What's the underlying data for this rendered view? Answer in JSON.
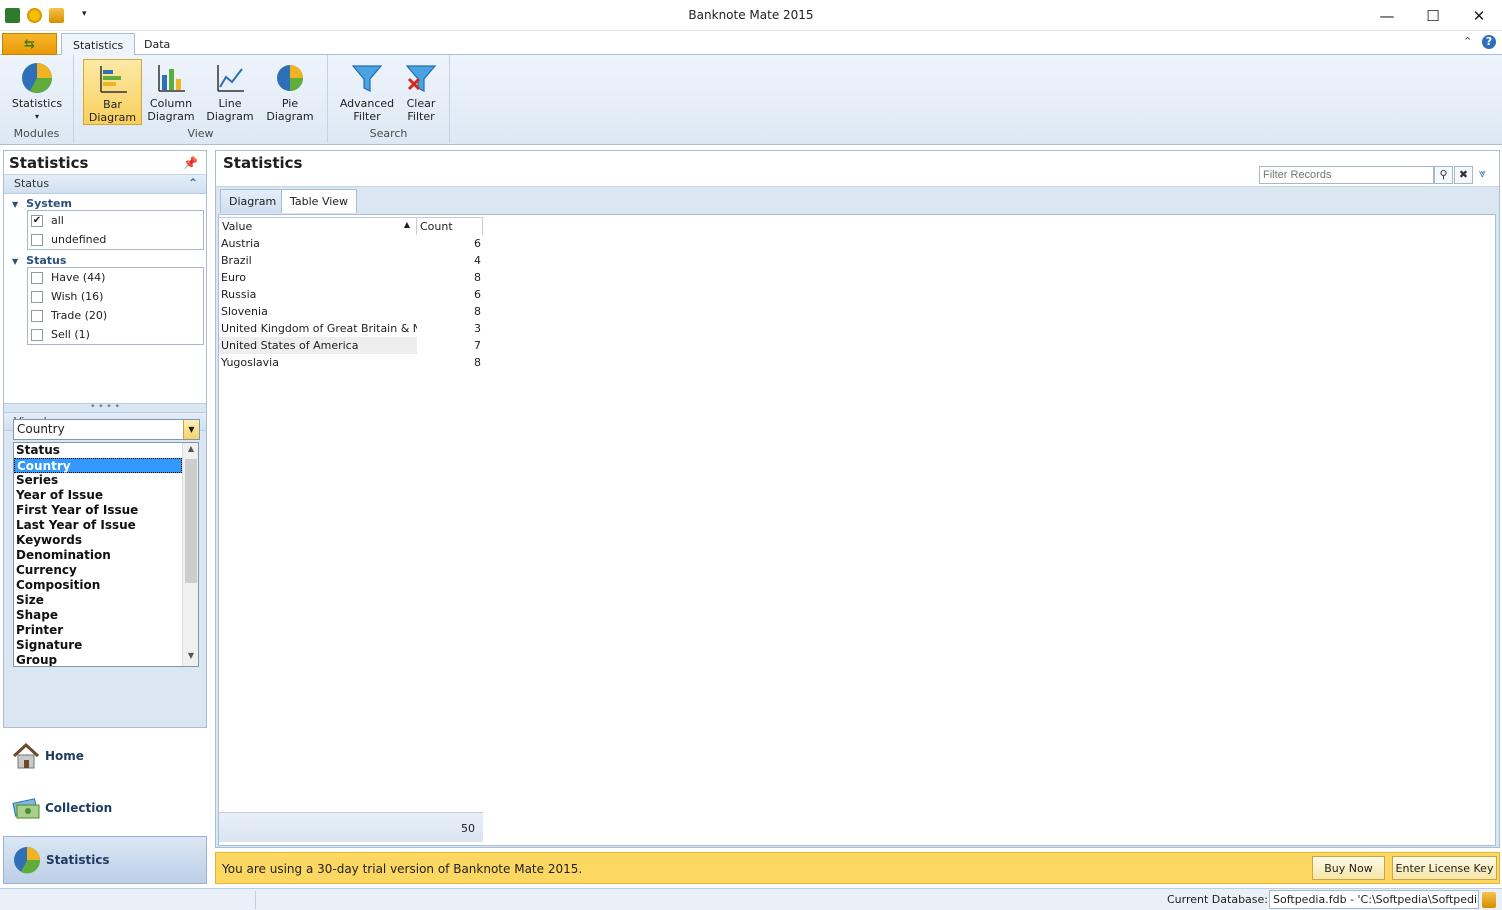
{
  "window": {
    "title": "Banknote Mate 2015",
    "minimize": "—",
    "maximize": "☐",
    "close": "✕"
  },
  "ribbon": {
    "tabs": [
      {
        "label": "Statistics",
        "active": true
      },
      {
        "label": "Data",
        "active": false
      }
    ],
    "groups": [
      {
        "label": "Modules",
        "buttons": [
          {
            "label1": "Statistics",
            "label2": "▾"
          }
        ]
      },
      {
        "label": "View",
        "buttons": [
          {
            "label1": "Bar",
            "label2": "Diagram",
            "active": true
          },
          {
            "label1": "Column",
            "label2": "Diagram"
          },
          {
            "label1": "Line",
            "label2": "Diagram"
          },
          {
            "label1": "Pie",
            "label2": "Diagram"
          }
        ]
      },
      {
        "label": "Search",
        "buttons": [
          {
            "label1": "Advanced",
            "label2": "Filter"
          },
          {
            "label1": "Clear",
            "label2": "Filter"
          }
        ]
      }
    ]
  },
  "left_panel": {
    "title": "Statistics",
    "status_section": "Status",
    "system_group": "System",
    "system_items": [
      {
        "label": "all",
        "checked": true
      },
      {
        "label": "undefined",
        "checked": false
      }
    ],
    "status_group": "Status",
    "status_items": [
      {
        "label": "Have (44)",
        "checked": false
      },
      {
        "label": "Wish (16)",
        "checked": false
      },
      {
        "label": "Trade (20)",
        "checked": false
      },
      {
        "label": "Sell (1)",
        "checked": false
      }
    ],
    "view_by_label": "View by",
    "view_by_value": "Country",
    "dropdown_options": [
      "Status",
      "Country",
      "Series",
      "Year of Issue",
      "First Year of Issue",
      "Last Year of Issue",
      "Keywords",
      "Denomination",
      "Currency",
      "Composition",
      "Size",
      "Shape",
      "Printer",
      "Signature",
      "Group"
    ],
    "dropdown_selected": "Country"
  },
  "nav": [
    {
      "label": "Home",
      "active": false
    },
    {
      "label": "Collection",
      "active": false
    },
    {
      "label": "Statistics",
      "active": true
    }
  ],
  "main": {
    "title": "Statistics",
    "filter_placeholder": "Filter Records",
    "view_tabs": [
      {
        "label": "Diagram",
        "active": false
      },
      {
        "label": "Table View",
        "active": true
      }
    ],
    "columns": [
      "Value",
      "Count"
    ],
    "rows": [
      {
        "value": "Austria",
        "count": "6"
      },
      {
        "value": "Brazil",
        "count": "4"
      },
      {
        "value": "Euro",
        "count": "8"
      },
      {
        "value": "Russia",
        "count": "6"
      },
      {
        "value": "Slovenia",
        "count": "8"
      },
      {
        "value": "United Kingdom of Great Britain & No",
        "count": "3"
      },
      {
        "value": "United States of America",
        "count": "7"
      },
      {
        "value": "Yugoslavia",
        "count": "8"
      }
    ],
    "total": "50"
  },
  "trial": {
    "message": "You are using a 30-day trial version of Banknote Mate 2015.",
    "buy_label": "Buy Now",
    "license_label": "Enter License Key"
  },
  "status_bar": {
    "db_label": "Current Database:",
    "db_value": "Softpedia.fdb - 'C:\\Softpedia\\Softpedia.fdb'"
  },
  "colors": {
    "accent": "#2e6fb7",
    "ribbon_active": "#f7cf5c",
    "trial_bar": "#fcd862",
    "selection": "#3399ff"
  }
}
